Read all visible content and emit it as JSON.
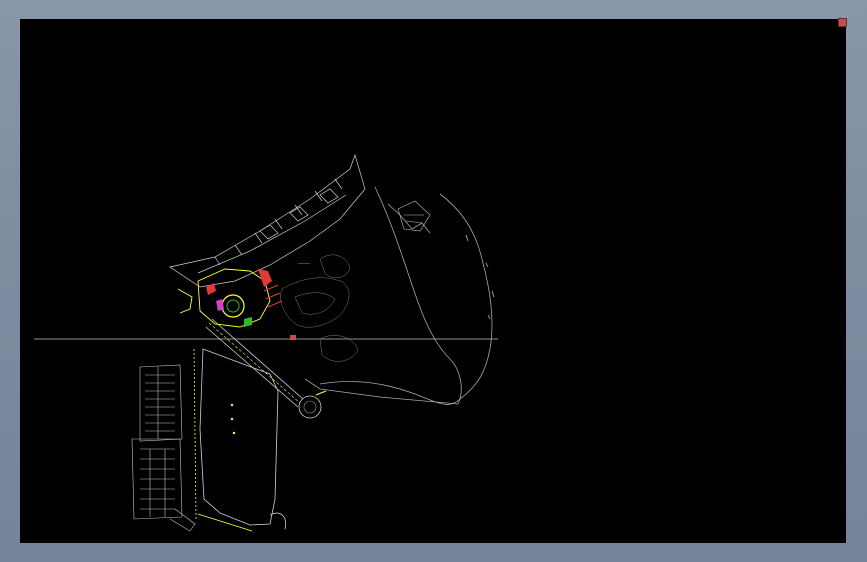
{
  "viewer": {
    "background_color": "#7f8da1",
    "canvas_color": "#000000",
    "marker_color": "#c0504d",
    "icons": [
      "corner-marker"
    ]
  },
  "drawing": {
    "line_colors": {
      "primary": "#d0d0d0",
      "secondary": "#9a9a9a",
      "highlight": "#ffff33",
      "accent_red": "#e23a3a",
      "accent_green": "#2dbb2d",
      "accent_magenta": "#d040d0"
    },
    "crosshair_visible": true
  }
}
